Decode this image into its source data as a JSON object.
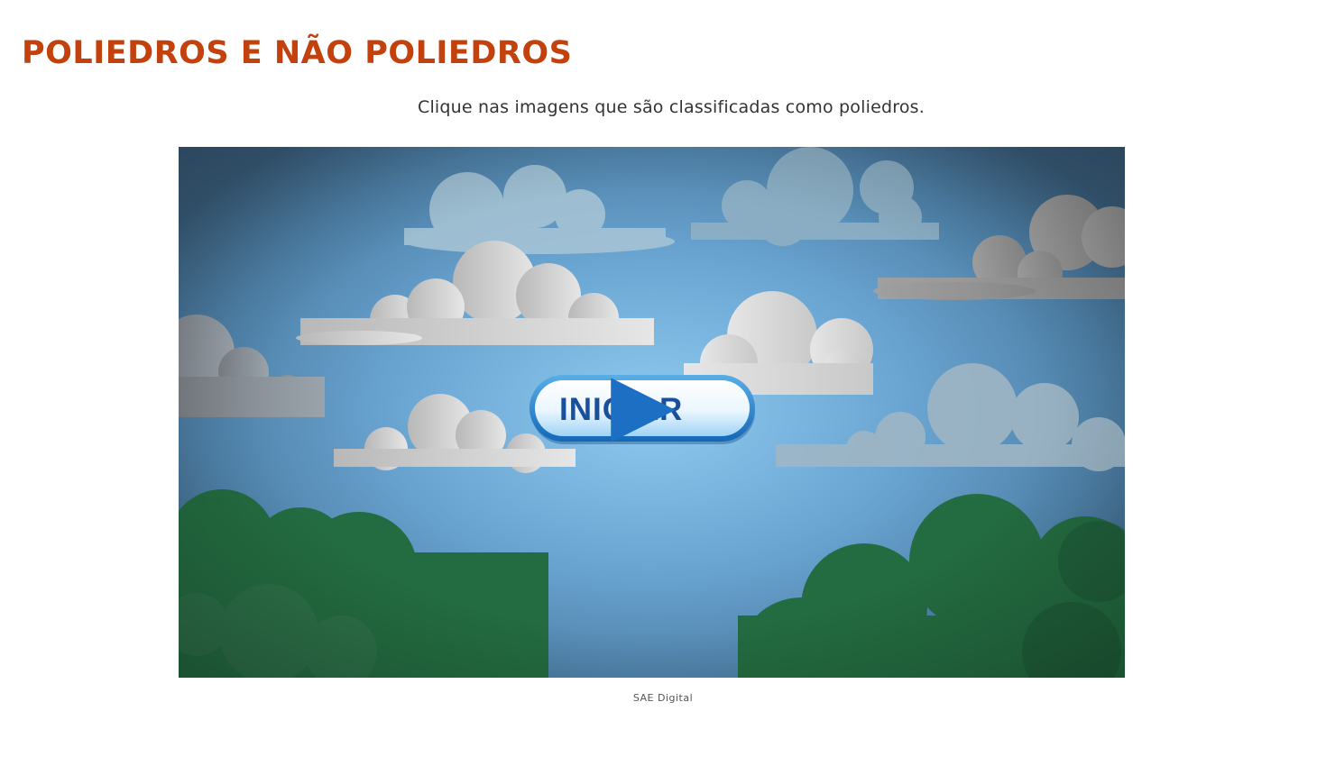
{
  "header": {
    "title": "POLIEDROS E NÃO POLIEDROS"
  },
  "instruction": "Clique nas imagens que são classificadas como poliedros.",
  "game": {
    "start_label": "INICIAR",
    "start_icon": "play-icon"
  },
  "credit": "SAE Digital",
  "colors": {
    "title": "#c2410c",
    "button_text": "#1a4f9c",
    "sky": "#8fcaf0",
    "foliage": "#236b40"
  }
}
